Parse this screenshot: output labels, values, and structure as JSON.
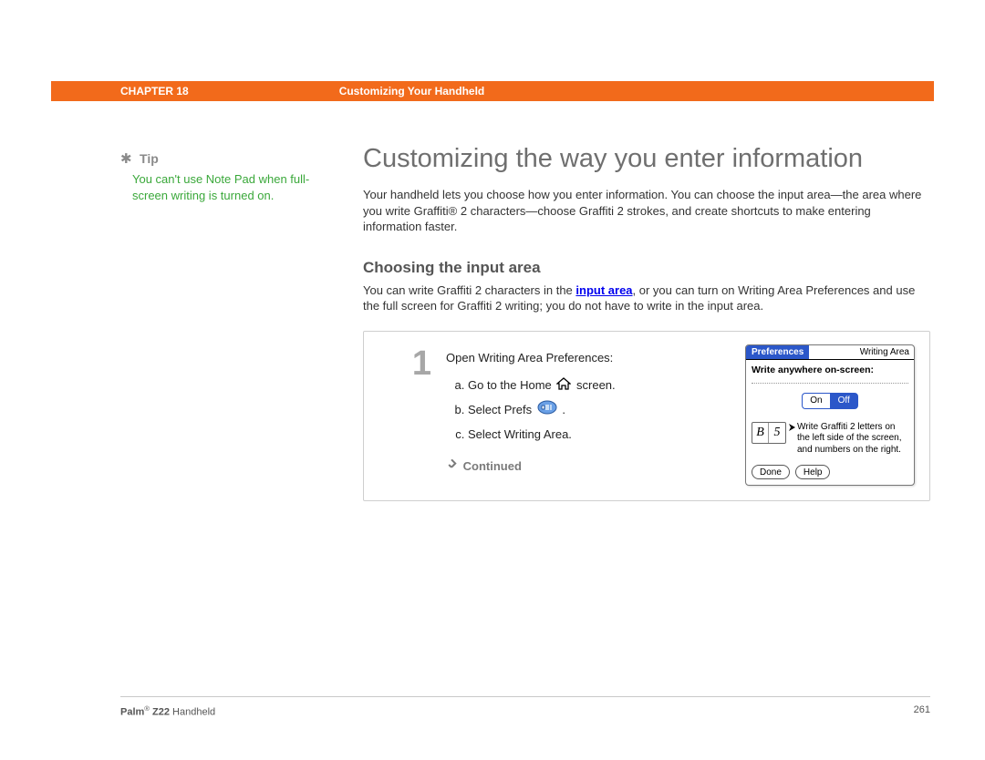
{
  "header": {
    "chapter": "CHAPTER 18",
    "title": "Customizing Your Handheld"
  },
  "sidebar": {
    "tip_label": "Tip",
    "tip_text": "You can't use Note Pad when full-screen writing is turned on."
  },
  "main": {
    "h1": "Customizing the way you enter information",
    "intro": "Your handheld lets you choose how you enter information. You can choose the input area—the area where you write Graffiti® 2 characters—choose Graffiti 2 strokes, and create shortcuts to make entering information faster.",
    "h2": "Choosing the input area",
    "sub_intro_a": "You can write Graffiti 2 characters in the ",
    "sub_intro_link": "input area",
    "sub_intro_b": ", or you can turn on Writing Area Preferences and use the full screen for Graffiti 2 writing; you do not have to write in the input area."
  },
  "step": {
    "num": "1",
    "lead": "Open Writing Area Preferences:",
    "a_pre": "Go to the Home ",
    "a_post": " screen.",
    "b_pre": "Select Prefs ",
    "b_post": ".",
    "c": "Select Writing Area.",
    "continued": "Continued"
  },
  "screenshot": {
    "titlebar_left": "Preferences",
    "titlebar_right": "Writing Area",
    "heading": "Write anywhere on-screen:",
    "toggle_on": "On",
    "toggle_off": "Off",
    "glyph_b": "B",
    "glyph_5": "5",
    "instr": "Write Graffiti 2 letters on the left side of the screen, and numbers on the right.",
    "btn_done": "Done",
    "btn_help": "Help"
  },
  "footer": {
    "prod": "Palm",
    "model": "Z22",
    "tail": " Handheld",
    "page": "261"
  }
}
